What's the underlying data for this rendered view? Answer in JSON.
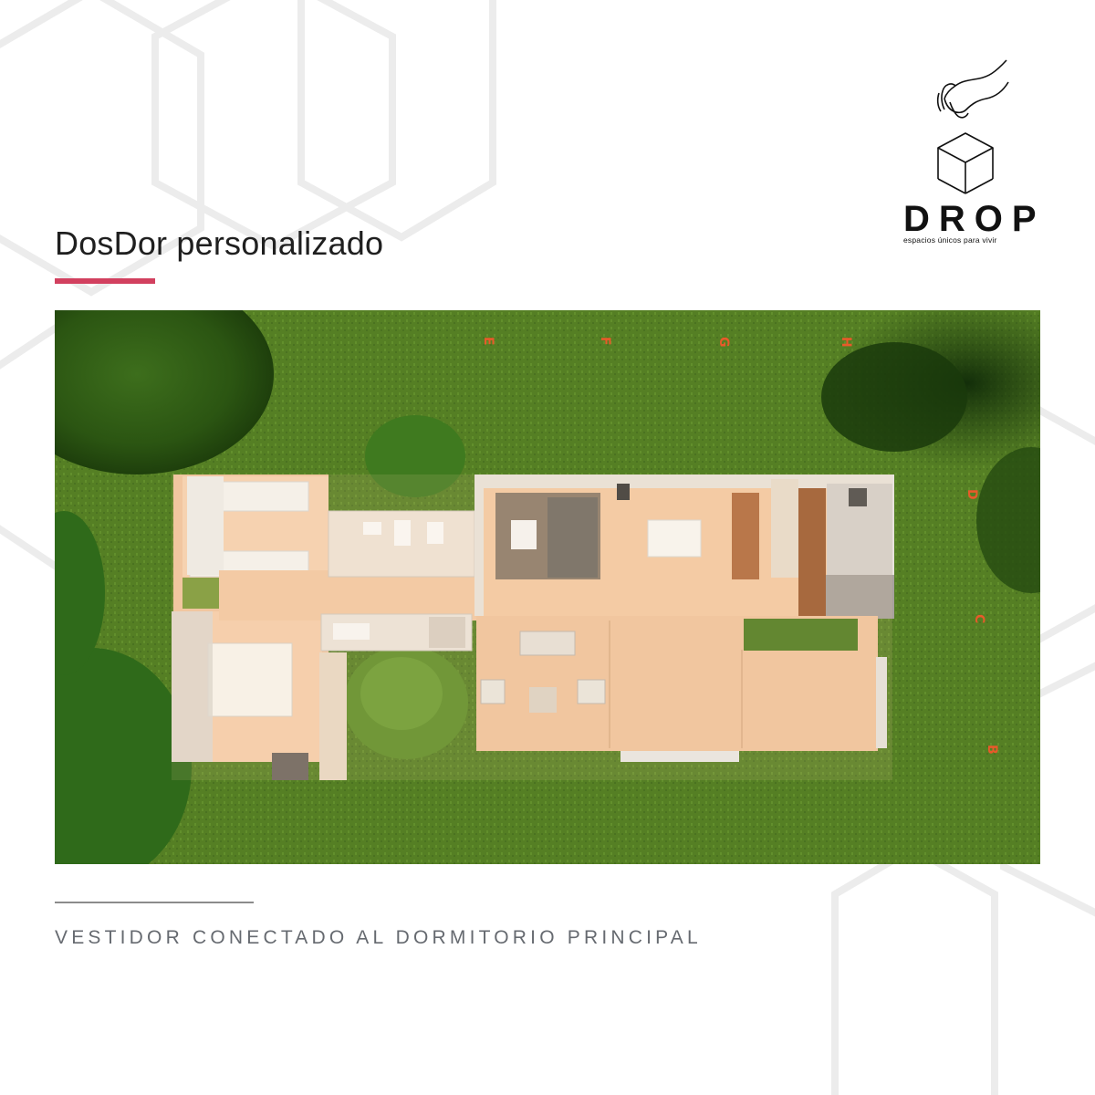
{
  "title": "DosDor personalizado",
  "caption": "VESTIDOR CONECTADO AL DORMITORIO PRINCIPAL",
  "brand": {
    "name": "DROP",
    "tagline": "espacios únicos para vivir",
    "logo_icon": "hand-dropping-cube"
  },
  "render": {
    "description_icon": "aerial-floor-plan-render",
    "grid_markers_top": [
      "E",
      "F",
      "G",
      "H"
    ],
    "grid_markers_right": [
      "D",
      "C",
      "B"
    ]
  },
  "colors": {
    "accent": "#d2405f",
    "text": "#1f1f1f",
    "caption": "#666a70",
    "grass": "#4f7a22",
    "floor": "#f2c7a3",
    "marker": "#e85a2a"
  }
}
